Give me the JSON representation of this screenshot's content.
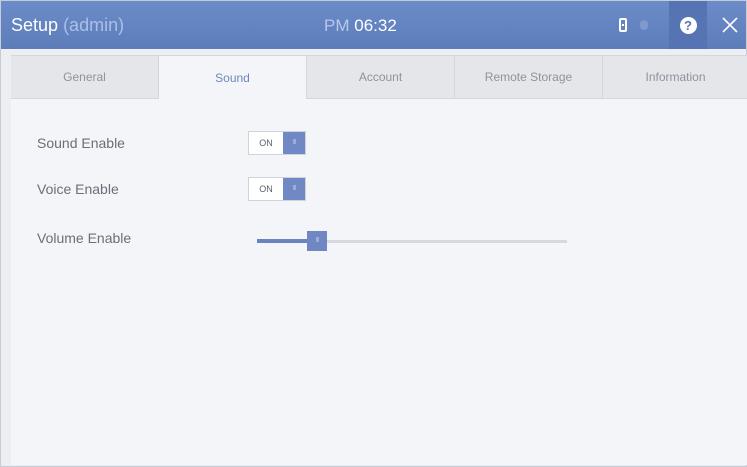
{
  "titlebar": {
    "title": "Setup",
    "user": "(admin)",
    "clock_period": "PM",
    "clock_time": "06:32",
    "icons": [
      "battery-icon",
      "help-icon",
      "close-icon"
    ]
  },
  "tabs": [
    {
      "label": "General",
      "active": false
    },
    {
      "label": "Sound",
      "active": true
    },
    {
      "label": "Account",
      "active": false
    },
    {
      "label": "Remote Storage",
      "active": false
    },
    {
      "label": "Information",
      "active": false
    }
  ],
  "settings": {
    "sound_enable": {
      "label": "Sound Enable",
      "state": "ON",
      "knob": "III"
    },
    "voice_enable": {
      "label": "Voice Enable",
      "state": "ON",
      "knob": "III"
    },
    "volume": {
      "label": "Volume Enable",
      "value_fraction": 0.13,
      "knob": "III"
    }
  },
  "colors": {
    "accent": "#6f88c3",
    "titlebar": "#6382c0",
    "active_tab_text": "#6d88bf"
  }
}
